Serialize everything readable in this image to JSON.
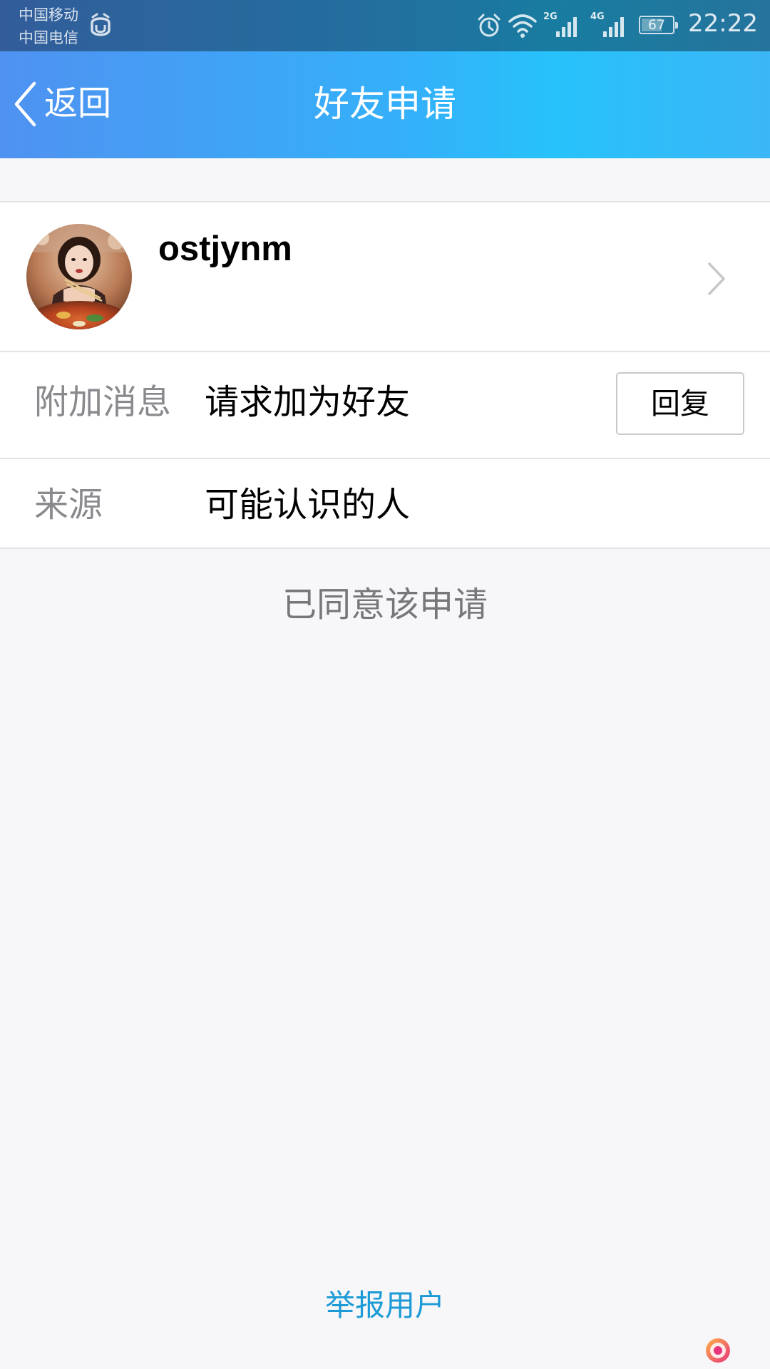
{
  "status_bar": {
    "carrier_1": "中国移动",
    "carrier_2": "中国电信",
    "notification_icon": "app-notification-icon",
    "alarm_icon": "alarm-clock-icon",
    "wifi_icon": "wifi-icon",
    "network_1": "2G",
    "network_2": "4G",
    "battery_percent": "67",
    "battery_level": 0.67,
    "time": "22:22"
  },
  "nav": {
    "back_label": "返回",
    "title": "好友申请"
  },
  "profile": {
    "username": "ostjynm",
    "avatar_icon": "user-avatar-photo"
  },
  "details": {
    "message_label": "附加消息",
    "message_value": "请求加为好友",
    "reply_label": "回复",
    "source_label": "来源",
    "source_value": "可能认识的人"
  },
  "status_text": "已同意该申请",
  "report_label": "举报用户",
  "colors": {
    "header_gradient_start": "#4f92f1",
    "header_gradient_end": "#27c2fb",
    "link": "#1c9ad5",
    "background": "#f7f7f9"
  }
}
